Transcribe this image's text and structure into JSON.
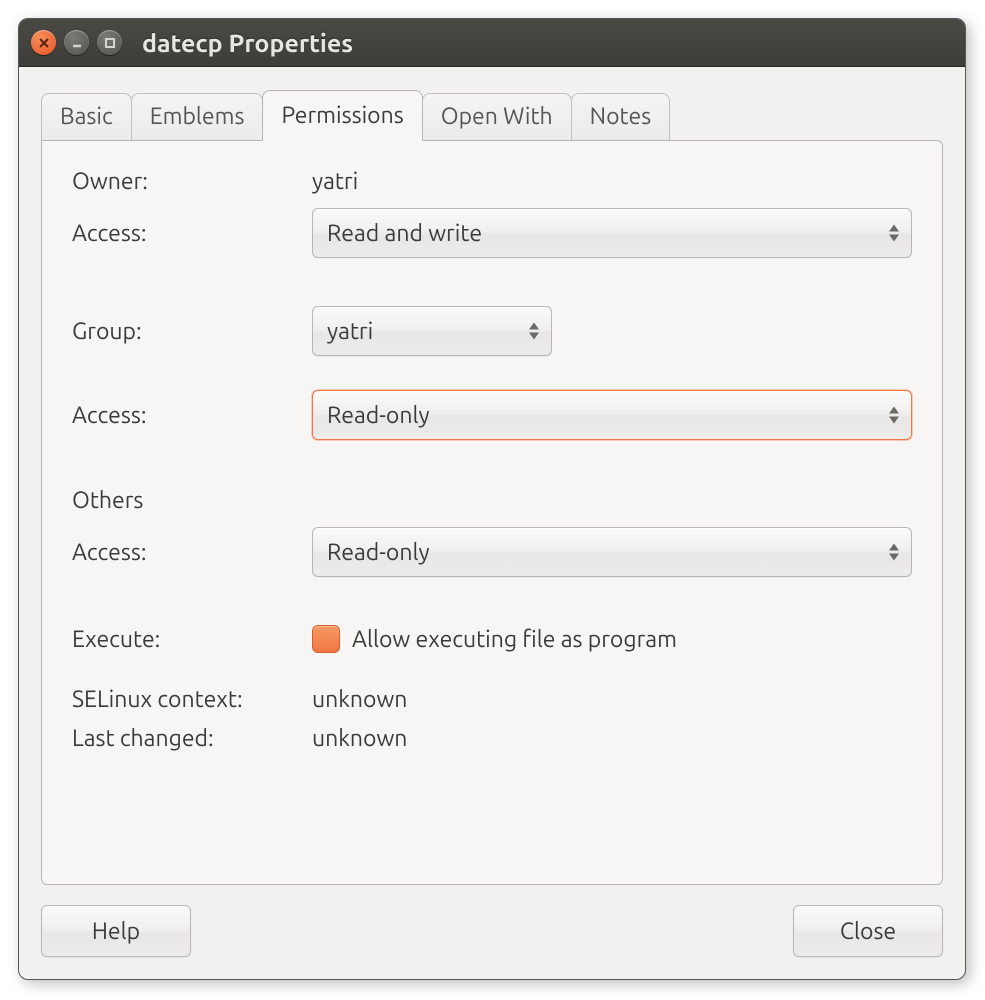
{
  "window": {
    "title": "datecp Properties"
  },
  "tabs": {
    "basic": "Basic",
    "emblems": "Emblems",
    "permissions": "Permissions",
    "openwith": "Open With",
    "notes": "Notes"
  },
  "labels": {
    "owner": "Owner:",
    "access": "Access:",
    "group": "Group:",
    "others": "Others",
    "execute": "Execute:",
    "selinux": "SELinux context:",
    "lastchanged": "Last changed:"
  },
  "values": {
    "owner": "yatri",
    "owner_access": "Read and write",
    "group": "yatri",
    "group_access": "Read-only",
    "others_access": "Read-only",
    "execute_label": "Allow executing file as program",
    "selinux": "unknown",
    "lastchanged": "unknown"
  },
  "buttons": {
    "help": "Help",
    "close": "Close"
  }
}
